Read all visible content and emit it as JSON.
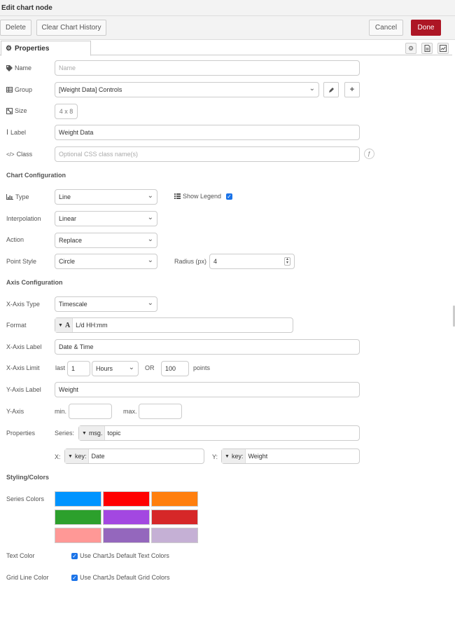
{
  "header": {
    "title": "Edit chart node"
  },
  "toolbar": {
    "delete": "Delete",
    "clear_history": "Clear Chart History",
    "cancel": "Cancel",
    "done": "Done"
  },
  "tabs": {
    "properties": "Properties"
  },
  "fields": {
    "name": {
      "label": "Name",
      "placeholder": "Name"
    },
    "group": {
      "label": "Group",
      "value": "[Weight Data] Controls"
    },
    "size": {
      "label": "Size",
      "value": "4 x 8"
    },
    "label": {
      "label": "Label",
      "value": "Weight Data"
    },
    "class": {
      "label": "Class",
      "placeholder": "Optional CSS class name(s)"
    }
  },
  "chart_config": {
    "heading": "Chart Configuration",
    "type": {
      "label": "Type",
      "value": "Line"
    },
    "show_legend": {
      "label": "Show Legend",
      "checked": true
    },
    "interpolation": {
      "label": "Interpolation",
      "value": "Linear"
    },
    "action": {
      "label": "Action",
      "value": "Replace"
    },
    "point_style": {
      "label": "Point Style",
      "value": "Circle"
    },
    "radius": {
      "label": "Radius (px)",
      "value": "4"
    }
  },
  "axis_config": {
    "heading": "Axis Configuration",
    "x_axis_type": {
      "label": "X-Axis Type",
      "value": "Timescale"
    },
    "format": {
      "label": "Format",
      "value": "L/d HH:mm"
    },
    "x_axis_label": {
      "label": "X-Axis Label",
      "value": "Date & Time"
    },
    "x_axis_limit": {
      "label": "X-Axis Limit",
      "last": "last",
      "count": "1",
      "unit": "Hours",
      "or": "OR",
      "points_value": "100",
      "points": "points"
    },
    "y_axis_label": {
      "label": "Y-Axis Label",
      "value": "Weight"
    },
    "y_axis": {
      "label": "Y-Axis",
      "min_label": "min.",
      "min": "",
      "max_label": "max.",
      "max": ""
    },
    "properties": {
      "label": "Properties",
      "series_label": "Series:",
      "series_type": "msg.",
      "series_value": "topic",
      "x_label": "X:",
      "x_type": "key:",
      "x_value": "Date",
      "y_label": "Y:",
      "y_type": "key:",
      "y_value": "Weight"
    }
  },
  "styling": {
    "heading": "Styling/Colors",
    "series_colors_label": "Series Colors",
    "series_colors": [
      "#0094ff",
      "#ff0000",
      "#ff7f0e",
      "#2ca02c",
      "#a347e1",
      "#d62728",
      "#ff9896",
      "#9467bd",
      "#c5b0d5"
    ],
    "text_color": {
      "label": "Text Color",
      "option": "Use ChartJs Default Text Colors",
      "checked": true
    },
    "grid_line_color": {
      "label": "Grid Line Color",
      "option": "Use ChartJs Default Grid Colors",
      "checked": true
    }
  },
  "colors": {
    "accent": "#ad1625",
    "checkbox": "#1a73e8"
  }
}
